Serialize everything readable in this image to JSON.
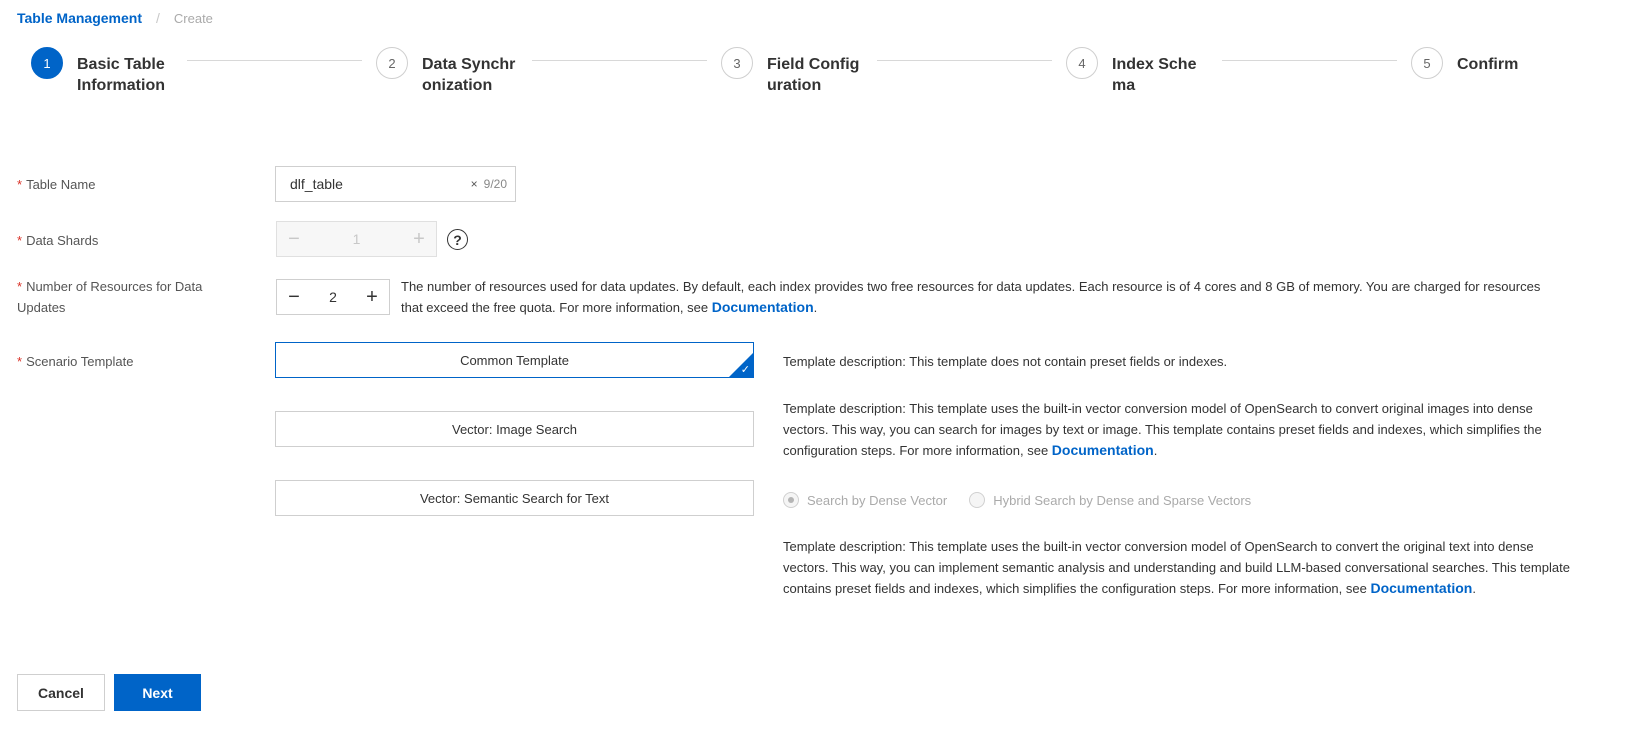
{
  "breadcrumb": {
    "parent": "Table Management",
    "separator": "/",
    "current": "Create"
  },
  "steps": [
    {
      "number": "1",
      "title": "Basic Table Information"
    },
    {
      "number": "2",
      "title": "Data Synchronization"
    },
    {
      "number": "3",
      "title": "Field Configuration"
    },
    {
      "number": "4",
      "title": "Index Schema"
    },
    {
      "number": "5",
      "title": "Confirm"
    }
  ],
  "active_step": 1,
  "form": {
    "required_mark": "*",
    "table_name": {
      "label": "Table Name",
      "value": "dlf_table",
      "counter": "9/20",
      "clear_glyph": "×"
    },
    "data_shards": {
      "label": "Data Shards",
      "value": "1",
      "minus": "−",
      "plus": "+",
      "help": "?"
    },
    "resources": {
      "label": "Number of Resources for Data Updates",
      "value": "2",
      "minus": "−",
      "plus": "+",
      "description": "The number of resources used for data updates. By default, each index provides two free resources for data updates. Each resource is of 4 cores and 8 GB of memory. You are charged for resources that exceed the free quota. For more information, see ",
      "link": "Documentation",
      "suffix": "."
    },
    "scenario": {
      "label": "Scenario Template",
      "templates": [
        {
          "label": "Common Template",
          "selected": true,
          "description": "Template description: This template does not contain preset fields or indexes."
        },
        {
          "label": "Vector: Image Search",
          "selected": false,
          "description": "Template description: This template uses the built-in vector conversion model of OpenSearch to convert original images into dense vectors. This way, you can search for images by text or image. This template contains preset fields and indexes, which simplifies the configuration steps. For more information, see ",
          "link": "Documentation",
          "suffix": "."
        },
        {
          "label": "Vector: Semantic Search for Text",
          "selected": false,
          "description": "Template description: This template uses the built-in vector conversion model of OpenSearch to convert the original text into dense vectors. This way, you can implement semantic analysis and understanding and build LLM-based conversational searches. This template contains preset fields and indexes, which simplifies the configuration steps. For more information, see ",
          "link": "Documentation",
          "suffix": "."
        }
      ],
      "radios": [
        {
          "label": "Search by Dense Vector",
          "checked": true
        },
        {
          "label": "Hybrid Search by Dense and Sparse Vectors",
          "checked": false
        }
      ],
      "check_glyph": "✓"
    }
  },
  "buttons": {
    "cancel": "Cancel",
    "next": "Next"
  },
  "colors": {
    "accent": "#0064c8",
    "required": "#d93026",
    "border": "#cfcfcf"
  }
}
